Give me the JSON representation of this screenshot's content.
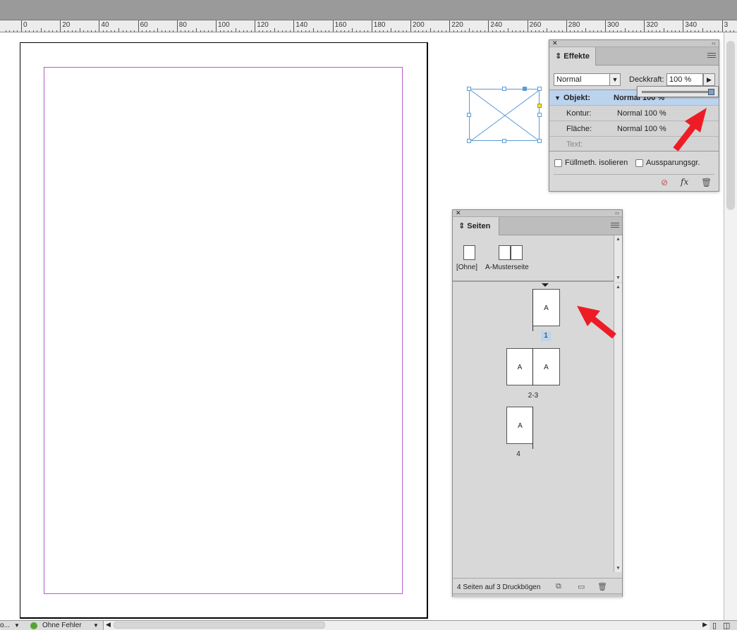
{
  "ruler": {
    "labels": [
      "0",
      "20",
      "40",
      "60",
      "80",
      "100",
      "120",
      "140",
      "160",
      "180",
      "200",
      "220",
      "240",
      "260",
      "280",
      "300",
      "320",
      "340",
      "3"
    ]
  },
  "effekte": {
    "tab_label": "Effekte",
    "blend_mode": "Normal",
    "opacity_label": "Deckkraft:",
    "opacity_value": "100 %",
    "rows": [
      {
        "name": "Objekt:",
        "value": "Normal 100 %"
      },
      {
        "name": "Kontur:",
        "value": "Normal 100 %"
      },
      {
        "name": "Fläche:",
        "value": "Normal 100 %"
      },
      {
        "name": "Text:",
        "value": ""
      }
    ],
    "check_isolate": "Füllmeth. isolieren",
    "check_knockout": "Aussparungsgr."
  },
  "seiten": {
    "tab_label": "Seiten",
    "master_none": "[Ohne]",
    "master_a": "A-Musterseite",
    "master_letter": "A",
    "page_labels": [
      "1",
      "2-3",
      "4"
    ],
    "footer_text": "4 Seiten auf 3 Druckbögen"
  },
  "status": {
    "profile": "o...",
    "preflight": "Ohne Fehler"
  },
  "colors": {
    "margin": "#b35cc9",
    "frame": "#5b9bd5",
    "selection": "#bcd3ee",
    "annotation_arrow": "#ee1c25"
  }
}
